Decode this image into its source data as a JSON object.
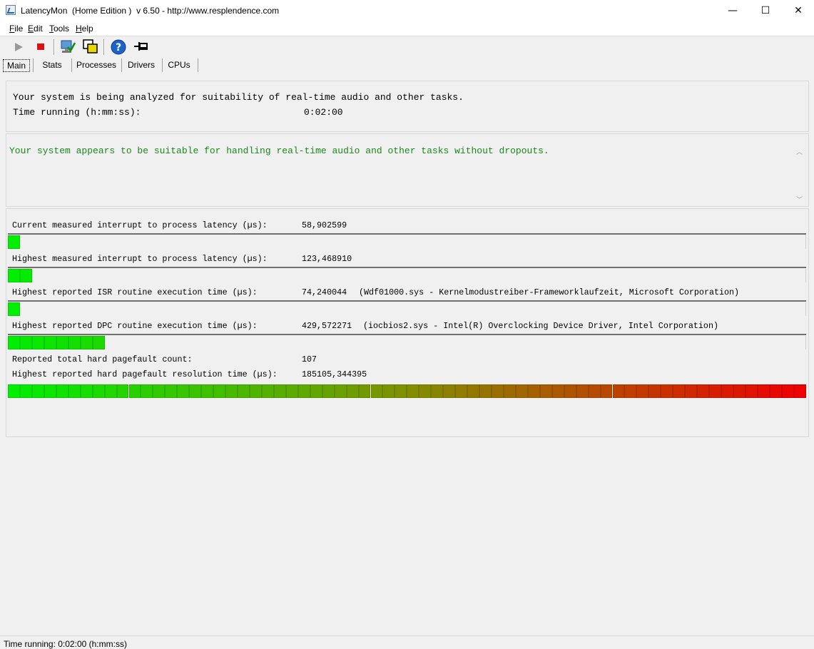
{
  "window": {
    "title": "LatencyMon  (Home Edition )  v 6.50 - http://www.resplendence.com",
    "minimize_glyph": "—",
    "maximize_glyph": "☐",
    "close_glyph": "✕"
  },
  "menu": {
    "items": [
      "File",
      "Edit",
      "Tools",
      "Help"
    ]
  },
  "toolbar": {
    "icons": [
      "play-icon",
      "stop-icon",
      "computer-check-icon",
      "windows-stack-icon",
      "help-icon",
      "pin-icon"
    ]
  },
  "tabs": {
    "items": [
      "Main",
      "Stats",
      "Processes",
      "Drivers",
      "CPUs"
    ],
    "active": "Main"
  },
  "analysis": {
    "line1": "Your system is being analyzed for suitability of real-time audio and other tasks.",
    "time_label": "Time running (h:mm:ss):",
    "time_value": "0:02:00"
  },
  "conclusion": {
    "text": "Your system appears to be suitable for handling real-time audio and other tasks without dropouts.",
    "color": "#1a8a1a"
  },
  "metrics": {
    "current_latency": {
      "label": "Current measured interrupt to process latency (µs):",
      "value": "58,902599",
      "level": 0.0125
    },
    "highest_latency": {
      "label": "Highest measured interrupt to process latency (µs):",
      "value": "123,468910",
      "level": 0.028
    },
    "isr": {
      "label": "Highest reported ISR routine execution time (µs):",
      "value": "74,240044",
      "detail": "(Wdf01000.sys - Kernelmodustreiber-Frameworklaufzeit, Microsoft Corporation)",
      "level": 0.0125
    },
    "dpc": {
      "label": "Highest reported DPC routine execution time (µs):",
      "value": "429,572271",
      "detail": "(iocbios2.sys - Intel(R) Overclocking Device Driver, Intel Corporation)",
      "level": 0.12
    },
    "pagefault_count": {
      "label": "Reported total hard pagefault count:",
      "value": "107"
    },
    "pagefault_time": {
      "label": "Highest reported hard pagefault resolution time (µs):",
      "value": "185105,344395",
      "level": 1.0
    }
  },
  "colors": {
    "meter_green": "#00ee00",
    "meter_red": "#ee0000"
  },
  "status": {
    "text": "Time running: 0:02:00  (h:mm:ss)"
  }
}
